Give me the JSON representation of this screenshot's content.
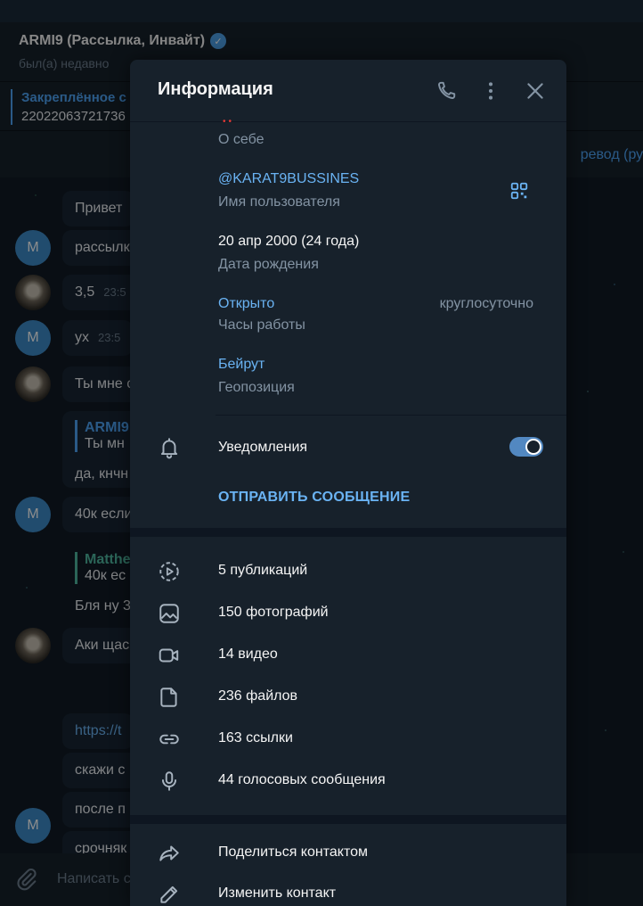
{
  "chat": {
    "title": "ARMI9 (Рассылка, Инвайт)",
    "status": "был(а) недавно",
    "pinned_title": "Закреплённое с",
    "pinned_text": "22022063721736",
    "translate_text": "ревод (рус",
    "input_placeholder": "Написать с",
    "avatar_letter": "M",
    "messages": [
      {
        "text": "Привет"
      },
      {
        "text": "рассылк"
      },
      {
        "text": "3,5",
        "time": "23:5"
      },
      {
        "text": "ух",
        "time": "23:5"
      },
      {
        "text": "Ты мне с"
      },
      {
        "quote_name": "ARMI9",
        "quote_text": "Ты мн",
        "text": "да, кнчн"
      },
      {
        "text": "40к если"
      },
      {
        "quote_name": "Matthe",
        "quote_text": "40к ес",
        "text": "Бля ну 3"
      },
      {
        "text": "Аки щас"
      },
      {
        "text": "https://t"
      },
      {
        "text": "скажи с"
      },
      {
        "text": "после п"
      },
      {
        "text": "срочняк"
      }
    ]
  },
  "panel": {
    "title": "Информация",
    "about_label": "О себе",
    "username": "@KARAT9BUSSINES",
    "username_label": "Имя пользователя",
    "birthday": "20 апр 2000 (24 года)",
    "birthday_label": "Дата рождения",
    "hours_status": "Открыто",
    "hours_value": "круглосуточно",
    "hours_label": "Часы работы",
    "location": "Бейрут",
    "location_label": "Геопозиция",
    "notifications_label": "Уведомления",
    "notifications_on": true,
    "send_message": "ОТПРАВИТЬ СООБЩЕНИЕ",
    "media": [
      {
        "icon": "story-icon",
        "label": "5 публикаций"
      },
      {
        "icon": "photo-icon",
        "label": "150 фотографий"
      },
      {
        "icon": "video-icon",
        "label": "14 видео"
      },
      {
        "icon": "file-icon",
        "label": "236 файлов"
      },
      {
        "icon": "link-icon",
        "label": "163 ссылки"
      },
      {
        "icon": "microphone-icon",
        "label": "44 голосовых сообщения"
      }
    ],
    "actions": [
      {
        "icon": "share-icon",
        "label": "Поделиться контактом"
      },
      {
        "icon": "pencil-icon",
        "label": "Изменить контакт"
      }
    ]
  },
  "colors": {
    "accent": "#6ab3f3",
    "panel_bg": "#17212b",
    "toggle_on": "#5288c1"
  }
}
